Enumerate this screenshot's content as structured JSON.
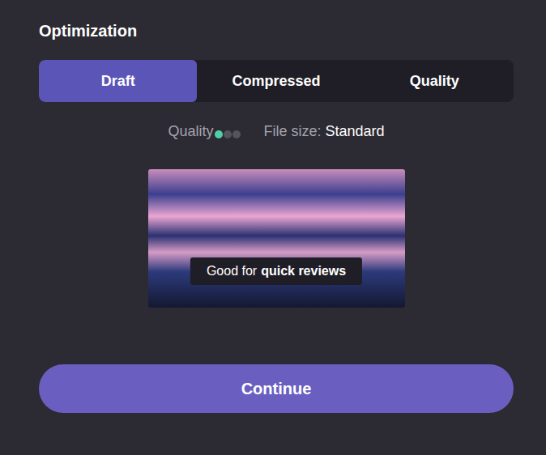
{
  "section": {
    "title": "Optimization"
  },
  "tabs": [
    {
      "label": "Draft",
      "selected": true
    },
    {
      "label": "Compressed",
      "selected": false
    },
    {
      "label": "Quality",
      "selected": false
    }
  ],
  "summary": {
    "quality_label": "Quality",
    "quality_dots": [
      {
        "on": true
      },
      {
        "on": false
      },
      {
        "on": false
      }
    ],
    "file_size_label": "File size:",
    "file_size_value": "Standard"
  },
  "preview": {
    "caption_prefix": "Good for",
    "caption_emphasis": "quick reviews"
  },
  "buttons": [
    "Continue"
  ]
}
